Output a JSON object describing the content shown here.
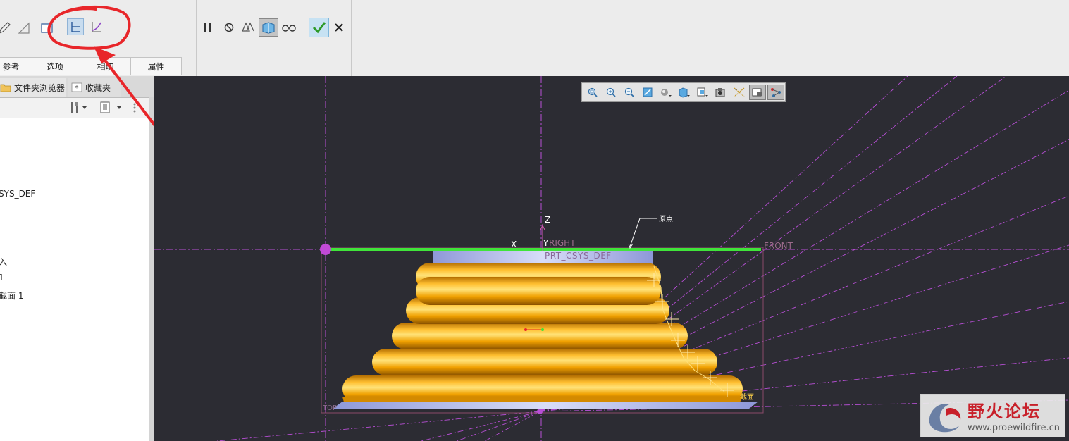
{
  "ribbon": {
    "tabs": [
      "参考",
      "选项",
      "相切",
      "属性"
    ]
  },
  "left_panel": {
    "tabs": [
      {
        "label": "文件夹浏览器",
        "icon": "folder-icon"
      },
      {
        "label": "收藏夹",
        "icon": "star-icon"
      }
    ],
    "tree_items": [
      "-",
      "SYS_DEF",
      "入",
      "1",
      "截面 1"
    ]
  },
  "viewport": {
    "labels": {
      "z_axis": "Z",
      "x_axis": "X",
      "y_axis": "Y",
      "right_plane": "RIGHT",
      "front_plane": "FRONT",
      "csys": "PRT_CSYS_DEF",
      "origin_note": "原点",
      "section_note": "截面",
      "top_plane": "TOP"
    }
  },
  "watermark": {
    "title": "野火论坛",
    "url": "www.proewildfire.cn"
  },
  "colors": {
    "viewport_bg": "#2c2c33",
    "ribbon_bg": "#ececec",
    "datum_purple": "#b84fd6",
    "trajectory_green": "#40e43a",
    "sweep_orange": "#f4a300",
    "annotation_red": "#e8262a"
  }
}
